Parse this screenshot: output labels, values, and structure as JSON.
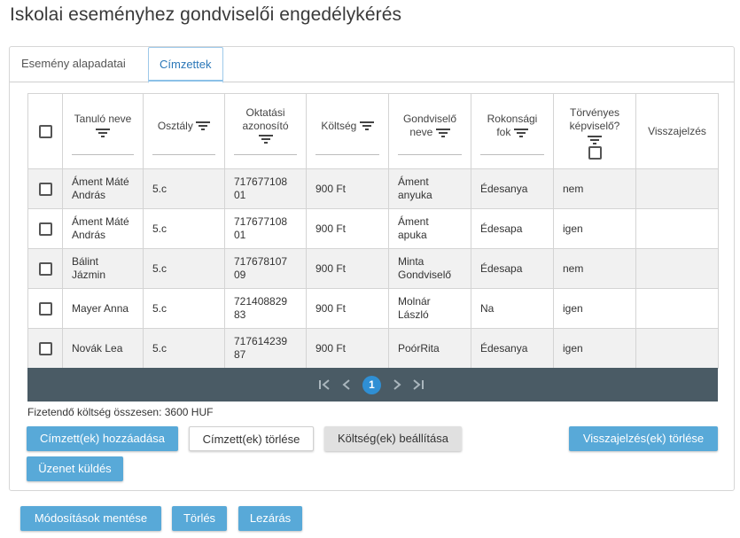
{
  "page": {
    "title": "Iskolai eseményhez gondviselői engedélykérés"
  },
  "tabs": [
    {
      "label": "Esemény alapadatai"
    },
    {
      "label": "Címzettek"
    }
  ],
  "table": {
    "headers": {
      "student": "Tanuló neve",
      "class": "Osztály",
      "edu_id_line1": "Oktatási",
      "edu_id_line2": "azonosító",
      "cost": "Költség",
      "guardian_line1": "Gondviselő",
      "guardian_line2": "neve",
      "relation_line1": "Rokonsági",
      "relation_line2": "fok",
      "legal_line1": "Törvényes",
      "legal_line2": "képviselő?",
      "feedback": "Visszajelzés"
    },
    "rows": [
      {
        "name1": "Áment Máté",
        "name2": "András",
        "class": "5.c",
        "id1": "717677108",
        "id2": "01",
        "cost": "900 Ft",
        "g1": "Áment",
        "g2": "anyuka",
        "relation": "Édesanya",
        "legal": "nem",
        "feedback": ""
      },
      {
        "name1": "Áment Máté",
        "name2": "András",
        "class": "5.c",
        "id1": "717677108",
        "id2": "01",
        "cost": "900 Ft",
        "g1": "Áment",
        "g2": "apuka",
        "relation": "Édesapa",
        "legal": "igen",
        "feedback": ""
      },
      {
        "name1": "Bálint",
        "name2": "Jázmin",
        "class": "5.c",
        "id1": "717678107",
        "id2": "09",
        "cost": "900 Ft",
        "g1": "Minta",
        "g2": "Gondviselő",
        "relation": "Édesapa",
        "legal": "nem",
        "feedback": ""
      },
      {
        "name1": "Mayer Anna",
        "name2": "",
        "class": "5.c",
        "id1": "721408829",
        "id2": "83",
        "cost": "900 Ft",
        "g1": "Molnár",
        "g2": "László",
        "relation": "Na",
        "legal": "igen",
        "feedback": ""
      },
      {
        "name1": "Novák Lea",
        "name2": "",
        "class": "5.c",
        "id1": "717614239",
        "id2": "87",
        "cost": "900 Ft",
        "g1": "PoórRita",
        "g2": "",
        "relation": "Édesanya",
        "legal": "igen",
        "feedback": ""
      }
    ]
  },
  "pager": {
    "current_page": "1",
    "icons": [
      "first-page-icon",
      "prev-page-icon",
      "next-page-icon",
      "last-page-icon"
    ]
  },
  "summary": {
    "total_text": "Fizetendő költség összesen: 3600 HUF"
  },
  "buttons": {
    "add_recipient": "Címzett(ek) hozzáadása",
    "delete_recipient": "Címzett(ek) törlése",
    "set_cost": "Költség(ek) beállítása",
    "delete_feedback": "Visszajelzés(ek) törlése",
    "send_message": "Üzenet küldés",
    "save_changes": "Módosítások mentése",
    "delete": "Törlés",
    "close": "Lezárás"
  },
  "colors": {
    "primary_button": "#58a9d8",
    "pager_bar": "#4a5b65",
    "active_page": "#2f8fd4",
    "active_tab_text": "#2a77b8"
  }
}
